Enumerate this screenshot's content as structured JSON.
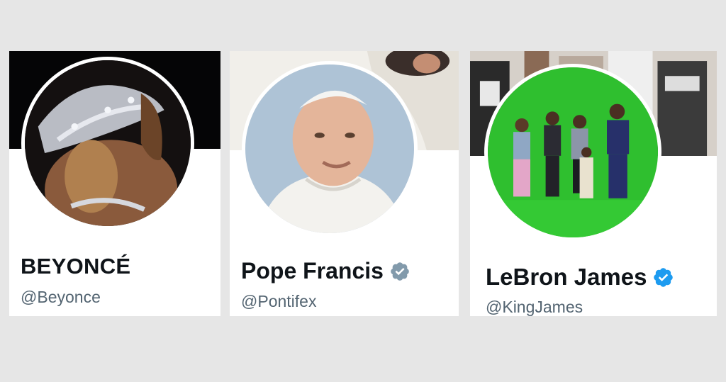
{
  "profiles": [
    {
      "display_name": "BEYONCÉ",
      "handle": "@Beyonce",
      "verified": false,
      "avatar_icon": "beyonce-avatar-image"
    },
    {
      "display_name": "Pope Francis",
      "handle": "@Pontifex",
      "verified": true,
      "badge_color": "#829aab",
      "avatar_icon": "pope-francis-avatar-image"
    },
    {
      "display_name": "LeBron James",
      "handle": "@KingJames",
      "verified": true,
      "badge_color": "#1d9bf0",
      "avatar_icon": "lebron-james-avatar-image"
    }
  ],
  "colors": {
    "page_background": "#e6e6e6",
    "card_background": "#ffffff",
    "name_text": "#0f1419",
    "handle_text": "#536471"
  }
}
